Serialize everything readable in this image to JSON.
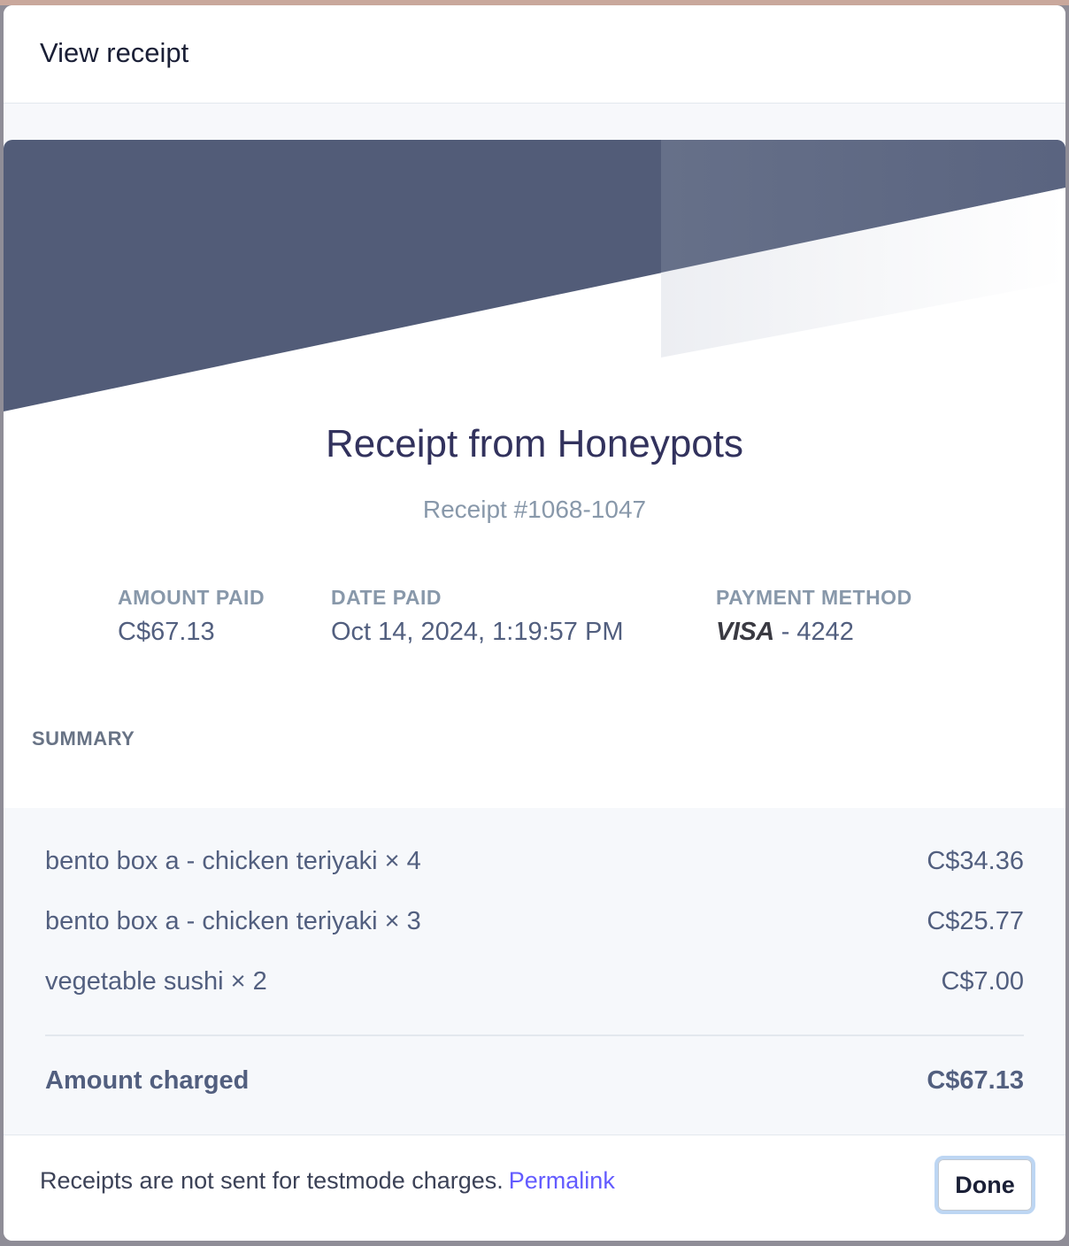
{
  "modal": {
    "title": "View receipt"
  },
  "receipt": {
    "title": "Receipt from Honeypots",
    "number": "Receipt #1068-1047",
    "banner_color": "#525c78",
    "meta": {
      "amount_paid_label": "AMOUNT PAID",
      "amount_paid_value": "C$67.13",
      "date_paid_label": "DATE PAID",
      "date_paid_value": "Oct 14, 2024, 1:19:57 PM",
      "payment_method_label": "PAYMENT METHOD",
      "card_brand": "VISA",
      "card_last4": "- 4242"
    },
    "summary": {
      "label": "SUMMARY",
      "items": [
        {
          "name": "bento box a - chicken teriyaki × 4",
          "amount": "C$34.36"
        },
        {
          "name": "bento box a - chicken teriyaki × 3",
          "amount": "C$25.77"
        },
        {
          "name": "vegetable sushi × 2",
          "amount": "C$7.00"
        }
      ],
      "total_label": "Amount charged",
      "total_amount": "C$67.13"
    }
  },
  "footer": {
    "note": "Receipts are not sent for testmode charges.",
    "permalink_label": "Permalink",
    "done_label": "Done"
  },
  "colors": {
    "accent_link": "#635bff",
    "focus_ring": "#bdd6f3"
  },
  "icons": {
    "card_brand_icon": "visa-logo"
  }
}
